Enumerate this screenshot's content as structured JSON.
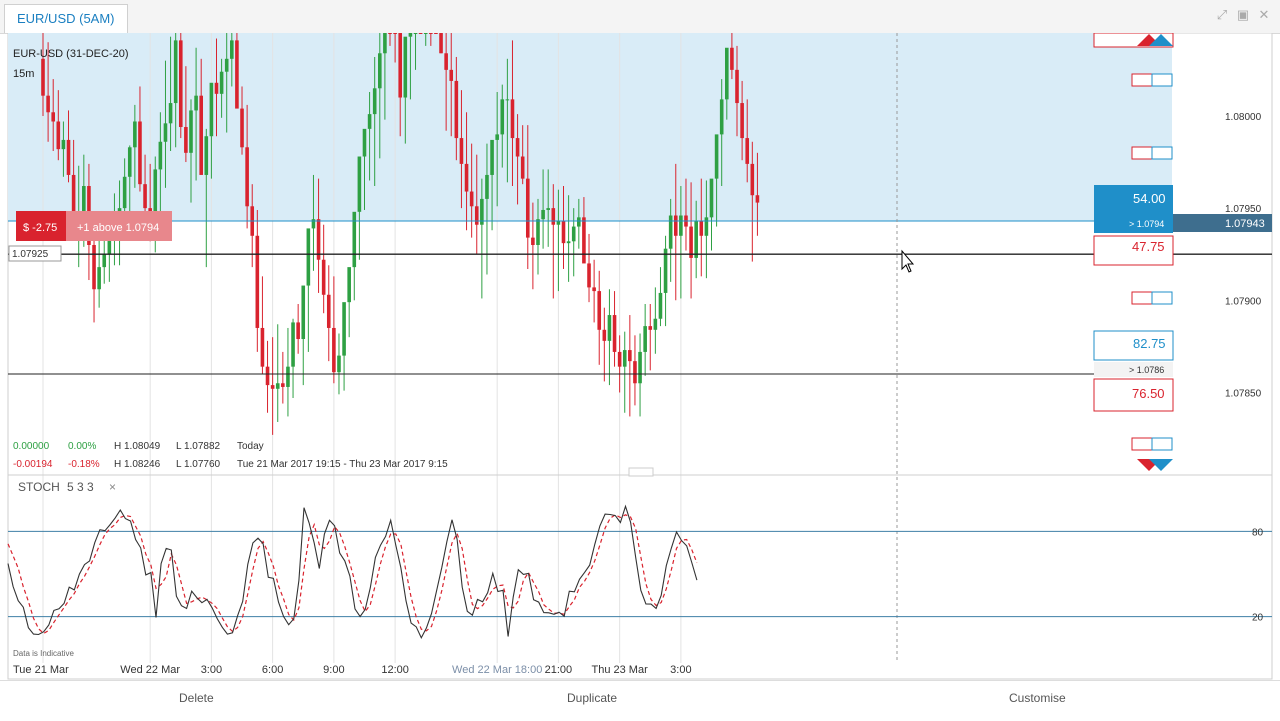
{
  "window": {
    "tab_title": "EUR/USD (5AM)"
  },
  "chart_info": {
    "instrument": "EUR-USD (31-DEC-20)",
    "timeframe": "15m",
    "current_price_label": "1.07943",
    "crosshair_price_label": "1.07925",
    "position_pl": "$ -2.75",
    "position_desc": "+1 above 1.0794",
    "data_note": "Data is Indicative"
  },
  "stats": {
    "row1": {
      "change": "0.00000",
      "pct": "0.00%",
      "high": "H 1.08049",
      "low": "L 1.07882",
      "period": "Today"
    },
    "row2": {
      "change": "-0.00194",
      "pct": "-0.18%",
      "high": "H 1.08246",
      "low": "L 1.07760",
      "period": "Tue 21 Mar 2017 19:15 - Thu 23 Mar 2017 9:15"
    }
  },
  "orders": {
    "buy_price": "54.00",
    "buy_level": "> 1.0794",
    "sell_price": "47.75",
    "buy2_price": "82.75",
    "buy2_level": "> 1.0786",
    "sell2_price": "76.50"
  },
  "indicator": {
    "name": "STOCH",
    "params": "5  3  3",
    "close_glyph": "×",
    "upper_level": "80",
    "lower_level": "20"
  },
  "toolbar": {
    "delete_label": "Delete",
    "duplicate_label": "Duplicate",
    "customise_label": "Customise"
  },
  "colors": {
    "up": "#2ea043",
    "down": "#d9232e",
    "zone": "#d9ecf7",
    "accent": "#1a7fc1",
    "stoch_k": "#333333",
    "stoch_d": "#d9232e"
  },
  "chart_data": {
    "type": "candlestick",
    "ylim": [
      1.07815,
      1.08045
    ],
    "y_ticks": [
      {
        "value": 1.08,
        "label": "1.08000"
      },
      {
        "value": 1.0795,
        "label": "1.07950"
      },
      {
        "value": 1.079,
        "label": "1.07900"
      },
      {
        "value": 1.0785,
        "label": "1.07850"
      }
    ],
    "x_ticks": [
      {
        "bar": 0,
        "label": "Tue 21 Mar"
      },
      {
        "bar": 21,
        "label": "Wed 22 Mar"
      },
      {
        "bar": 33,
        "label": "3:00"
      },
      {
        "bar": 45,
        "label": "6:00"
      },
      {
        "bar": 57,
        "label": "9:00"
      },
      {
        "bar": 69,
        "label": "12:00"
      },
      {
        "bar": 89,
        "label": "Wed 22 Mar 18:00"
      },
      {
        "bar": 101,
        "label": "21:00"
      },
      {
        "bar": 113,
        "label": "Thu 23 Mar"
      },
      {
        "bar": 125,
        "label": "3:00"
      }
    ],
    "reference_lines": [
      1.07943,
      1.07925,
      1.0786
    ],
    "highlight_zone": [
      1.07943,
      1.08045
    ],
    "open": [
      1.08031,
      1.08011,
      1.08002,
      1.07997,
      1.07982,
      1.07987,
      1.07968,
      1.0794,
      1.07948,
      1.07962,
      1.0793,
      1.07906,
      1.07918,
      1.07925,
      1.07935,
      1.07938,
      1.0795,
      1.07967,
      1.07983,
      1.07997,
      1.07963,
      1.0795,
      1.07946,
      1.07971,
      1.07986,
      1.07996,
      1.08007,
      1.08041,
      1.07994,
      1.0798,
      1.08003,
      1.08011,
      1.07968,
      1.07989,
      1.08018,
      1.08012,
      1.08024,
      1.08031,
      1.08041,
      1.08004,
      1.07983,
      1.07951,
      1.07935,
      1.07885,
      1.07864,
      1.07854,
      1.07852,
      1.07855,
      1.07853,
      1.07864,
      1.07888,
      1.07879,
      1.07908,
      1.07939,
      1.07944,
      1.07922,
      1.07903,
      1.07885,
      1.07861,
      1.0787,
      1.07899,
      1.07918,
      1.07948,
      1.07978,
      1.07993,
      1.08001,
      1.08015,
      1.08034,
      1.08065,
      1.08053,
      1.08052,
      1.0801,
      1.08043,
      1.08058,
      1.08068,
      1.08066,
      1.08079,
      1.08073,
      1.08051,
      1.08034,
      1.08025,
      1.08019,
      1.07988,
      1.07974,
      1.07959,
      1.07951,
      1.07941,
      1.07955,
      1.07968,
      1.07987,
      1.0799,
      1.08009,
      1.08009,
      1.07988,
      1.07978,
      1.07966,
      1.07934,
      1.0793,
      1.07944,
      1.07949,
      1.0795,
      1.07941,
      1.07943,
      1.07931,
      1.07932,
      1.0794,
      1.07945,
      1.0792,
      1.07907,
      1.07905,
      1.07884,
      1.07878,
      1.07892,
      1.07872,
      1.07864,
      1.07873,
      1.07867,
      1.07855,
      1.07872,
      1.07886,
      1.07884,
      1.0789,
      1.07904,
      1.07928,
      1.07946,
      1.07935,
      1.07946,
      1.0794,
      1.07923,
      1.07943,
      1.07935,
      1.07945,
      1.07966,
      1.0799,
      1.08009,
      1.08037,
      1.08025,
      1.08007,
      1.07988,
      1.07974,
      1.07957
    ],
    "high": [
      1.08059,
      1.0804,
      1.0802,
      1.08014,
      1.07997,
      1.08003,
      1.07987,
      1.07973,
      1.07979,
      1.07974,
      1.07936,
      1.07941,
      1.07945,
      1.07942,
      1.07958,
      1.07965,
      1.07977,
      1.07984,
      1.08006,
      1.08016,
      1.07979,
      1.07974,
      1.07978,
      1.08002,
      1.0803,
      1.08043,
      1.0805,
      1.08057,
      1.08027,
      1.08009,
      1.08037,
      1.08031,
      1.07993,
      1.08012,
      1.08042,
      1.08031,
      1.08051,
      1.08058,
      1.0806,
      1.08016,
      1.08006,
      1.07963,
      1.07949,
      1.07913,
      1.07878,
      1.0788,
      1.07887,
      1.07872,
      1.07885,
      1.0789,
      1.07898,
      1.07899,
      1.07935,
      1.07968,
      1.07966,
      1.07941,
      1.07919,
      1.07913,
      1.07882,
      1.07893,
      1.07915,
      1.07943,
      1.07967,
      1.07989,
      1.08013,
      1.08032,
      1.08046,
      1.08057,
      1.08089,
      1.08085,
      1.08066,
      1.08023,
      1.0807,
      1.08084,
      1.08093,
      1.08097,
      1.08088,
      1.08092,
      1.08076,
      1.08045,
      1.08052,
      1.08032,
      1.08014,
      1.08002,
      1.07985,
      1.07979,
      1.07966,
      1.07985,
      1.07981,
      1.08013,
      1.08017,
      1.08031,
      1.08041,
      1.08001,
      1.07995,
      1.07995,
      1.07953,
      1.07955,
      1.07971,
      1.07971,
      1.07963,
      1.0796,
      1.07962,
      1.07957,
      1.0795,
      1.07955,
      1.07956,
      1.07936,
      1.07922,
      1.07916,
      1.07896,
      1.07906,
      1.07905,
      1.07881,
      1.07883,
      1.07892,
      1.07881,
      1.07882,
      1.07898,
      1.07898,
      1.07907,
      1.07918,
      1.07935,
      1.07955,
      1.07974,
      1.07962,
      1.07966,
      1.07964,
      1.07954,
      1.07966,
      1.07965,
      1.07962,
      1.07989,
      1.0802,
      1.08034,
      1.08046,
      1.08038,
      1.08019,
      1.08009,
      1.07986,
      1.0798
    ],
    "low": [
      1.08,
      1.07986,
      1.07981,
      1.07976,
      1.07967,
      1.07964,
      1.07933,
      1.07918,
      1.07929,
      1.07911,
      1.07888,
      1.07896,
      1.07909,
      1.0791,
      1.07919,
      1.07919,
      1.07935,
      1.07944,
      1.07961,
      1.07959,
      1.07943,
      1.07932,
      1.07926,
      1.07941,
      1.07961,
      1.07981,
      1.07983,
      1.07988,
      1.07975,
      1.07953,
      1.07965,
      1.07984,
      1.07918,
      1.07966,
      1.07989,
      1.07999,
      1.07991,
      1.08016,
      1.08014,
      1.07979,
      1.07939,
      1.07918,
      1.07872,
      1.0786,
      1.07839,
      1.07827,
      1.07834,
      1.07844,
      1.07837,
      1.07847,
      1.07871,
      1.07854,
      1.07872,
      1.07916,
      1.07904,
      1.07893,
      1.07867,
      1.07855,
      1.07849,
      1.07851,
      1.0788,
      1.079,
      1.07922,
      1.07949,
      1.07965,
      1.07962,
      1.07977,
      1.07998,
      1.08038,
      1.08029,
      1.07989,
      1.07985,
      1.08009,
      1.08025,
      1.08046,
      1.08038,
      1.08038,
      1.08046,
      1.08034,
      1.07992,
      1.07989,
      1.07976,
      1.0795,
      1.07938,
      1.07934,
      1.07925,
      1.07901,
      1.07914,
      1.07938,
      1.07951,
      1.07972,
      1.07964,
      1.07962,
      1.07952,
      1.07963,
      1.07917,
      1.07906,
      1.07914,
      1.07928,
      1.07929,
      1.07901,
      1.07905,
      1.07917,
      1.0791,
      1.07913,
      1.07928,
      1.07926,
      1.07899,
      1.07888,
      1.07865,
      1.07856,
      1.07854,
      1.07864,
      1.0785,
      1.07839,
      1.07837,
      1.07843,
      1.07837,
      1.07859,
      1.07862,
      1.07871,
      1.07886,
      1.07886,
      1.0791,
      1.079,
      1.07901,
      1.07927,
      1.07901,
      1.07912,
      1.07913,
      1.07912,
      1.07927,
      1.0794,
      1.07962,
      1.07998,
      1.0802,
      1.07989,
      1.07976,
      1.07964,
      1.07921,
      1.07935
    ],
    "close": [
      1.08011,
      1.08002,
      1.07997,
      1.07982,
      1.07987,
      1.07968,
      1.0794,
      1.07948,
      1.07962,
      1.0793,
      1.07906,
      1.07918,
      1.07925,
      1.07935,
      1.07938,
      1.0795,
      1.07967,
      1.07983,
      1.07997,
      1.07963,
      1.0795,
      1.07946,
      1.07971,
      1.07986,
      1.07996,
      1.08007,
      1.08041,
      1.07994,
      1.0798,
      1.08003,
      1.08011,
      1.07968,
      1.07989,
      1.08018,
      1.08012,
      1.08024,
      1.08031,
      1.08041,
      1.08004,
      1.07983,
      1.07951,
      1.07935,
      1.07885,
      1.07864,
      1.07854,
      1.07852,
      1.07855,
      1.07853,
      1.07864,
      1.07888,
      1.07879,
      1.07908,
      1.07939,
      1.07944,
      1.07922,
      1.07903,
      1.07885,
      1.07861,
      1.0787,
      1.07899,
      1.07918,
      1.07948,
      1.07978,
      1.07993,
      1.08001,
      1.08015,
      1.08034,
      1.08065,
      1.08053,
      1.08052,
      1.0801,
      1.08043,
      1.08058,
      1.08068,
      1.08066,
      1.08079,
      1.08073,
      1.08051,
      1.08034,
      1.08025,
      1.08019,
      1.07988,
      1.07974,
      1.07959,
      1.07951,
      1.07941,
      1.07955,
      1.07968,
      1.07987,
      1.0799,
      1.08009,
      1.08009,
      1.07988,
      1.07978,
      1.07966,
      1.07934,
      1.0793,
      1.07944,
      1.07949,
      1.0795,
      1.07941,
      1.07943,
      1.07931,
      1.07932,
      1.0794,
      1.07945,
      1.0792,
      1.07907,
      1.07905,
      1.07884,
      1.07878,
      1.07892,
      1.07872,
      1.07864,
      1.07873,
      1.07867,
      1.07855,
      1.07872,
      1.07886,
      1.07884,
      1.0789,
      1.07904,
      1.07928,
      1.07946,
      1.07935,
      1.07946,
      1.0794,
      1.07923,
      1.07943,
      1.07935,
      1.07945,
      1.07966,
      1.0799,
      1.08009,
      1.08037,
      1.08025,
      1.08007,
      1.07988,
      1.07974,
      1.07957,
      1.07953
    ],
    "stoch": {
      "ylim": [
        0,
        100
      ],
      "levels": [
        80,
        20
      ],
      "k": [
        57.4,
        41.2,
        31.2,
        26.6,
        12.2,
        7.7,
        7.4,
        9.4,
        14.1,
        24.4,
        25.5,
        29.3,
        40.7,
        38.8,
        49.9,
        56.6,
        59.2,
        72.1,
        81.2,
        80.5,
        84.8,
        89.5,
        95.1,
        89.0,
        87.3,
        74.3,
        68.4,
        49.4,
        51.0,
        19.4,
        57.3,
        68.0,
        66.9,
        34.4,
        27.7,
        25.7,
        37.9,
        33.4,
        29.8,
        32.1,
        26.2,
        18.6,
        12.5,
        7.7,
        8.6,
        20.6,
        30.7,
        56.9,
        71.9,
        75.2,
        71.4,
        47.7,
        47.0,
        30.2,
        20.1,
        14.3,
        18.5,
        45.5,
        96.7,
        86.0,
        71.8,
        53.9,
        78.2,
        87.8,
        84.0,
        64.8,
        59.2,
        48.5,
        25.4,
        20.1,
        25.1,
        40.3,
        61.7,
        70.3,
        76.5,
        87.8,
        70.3,
        54.2,
        31.1,
        15.4,
        12.8,
        5.1,
        12.0,
        22.1,
        38.5,
        54.6,
        72.9,
        88.2,
        74.5,
        40.8,
        23.7,
        21.0,
        32.1,
        30.4,
        36.8,
        50.5,
        37.7,
        38.5,
        6.0,
        33.7,
        53.0,
        49.7,
        50.4,
        31.9,
        30.2,
        22.8,
        22.7,
        21.6,
        23.1,
        20.2,
        37.9,
        37.5,
        46.3,
        51.1,
        56.3,
        70.9,
        83.9,
        92.2,
        91.9,
        91.1,
        86.3,
        97.7,
        86.4,
        61.7,
        38.6,
        28.9,
        28.8,
        25.8,
        35.0,
        55.9,
        68.4,
        79.6,
        73.5,
        69.8,
        58.0,
        45.7
      ],
      "d": [
        71.3,
        62.8,
        54.1,
        41.0,
        30.7,
        18.9,
        11.4,
        8.2,
        10.3,
        16.0,
        21.3,
        26.4,
        31.8,
        36.3,
        43.1,
        48.4,
        55.2,
        62.6,
        70.8,
        77.9,
        82.1,
        84.9,
        89.8,
        91.2,
        90.5,
        83.5,
        76.7,
        64.0,
        56.3,
        39.9,
        42.6,
        48.2,
        64.1,
        56.4,
        43.0,
        29.3,
        30.4,
        32.3,
        33.7,
        31.8,
        29.4,
        25.6,
        19.1,
        12.9,
        9.6,
        12.3,
        20.0,
        36.1,
        53.2,
        68.0,
        72.8,
        64.8,
        55.4,
        41.6,
        32.4,
        21.5,
        17.6,
        26.1,
        53.6,
        76.1,
        84.8,
        70.6,
        68.0,
        73.3,
        83.3,
        78.9,
        69.3,
        57.5,
        44.4,
        31.3,
        23.5,
        28.5,
        42.4,
        57.4,
        69.5,
        78.2,
        78.2,
        70.8,
        51.9,
        33.6,
        19.8,
        11.1,
        10.0,
        13.1,
        24.2,
        38.4,
        55.3,
        71.9,
        78.5,
        67.8,
        46.3,
        28.5,
        25.6,
        27.8,
        33.1,
        39.2,
        41.7,
        42.2,
        27.4,
        26.1,
        30.9,
        45.5,
        51.0,
        44.0,
        37.5,
        28.3,
        25.2,
        22.4,
        22.5,
        21.6,
        27.1,
        31.9,
        40.6,
        45.0,
        51.2,
        59.4,
        70.4,
        82.3,
        89.3,
        91.7,
        89.8,
        91.7,
        90.1,
        81.9,
        62.2,
        43.1,
        32.1,
        27.8,
        29.9,
        39.6,
        53.1,
        68.0,
        73.8,
        74.3,
        67.1,
        57.8
      ]
    }
  }
}
